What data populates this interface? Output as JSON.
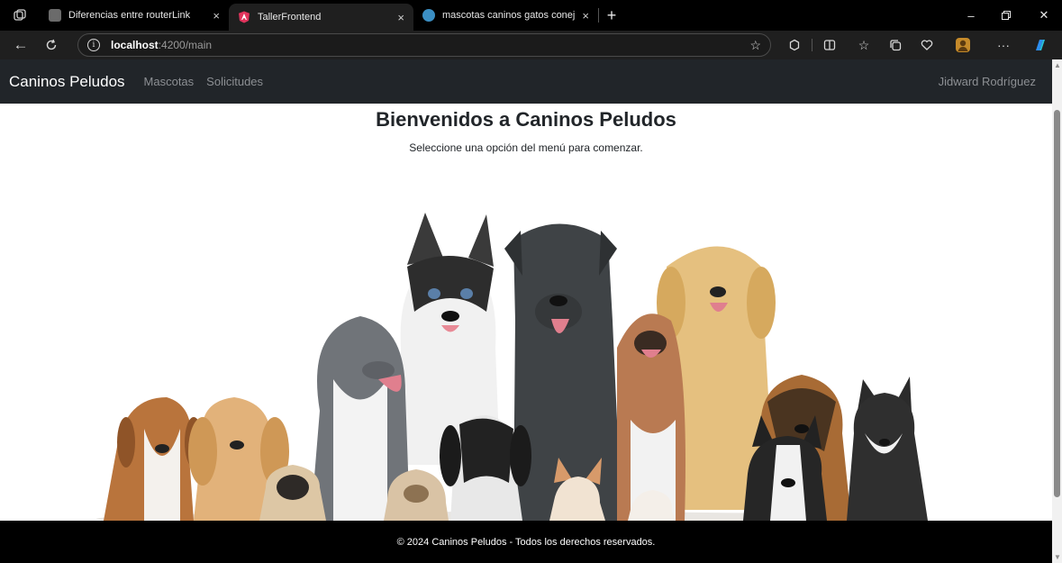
{
  "browser": {
    "tabs": [
      {
        "title": "Diferencias entre routerLink",
        "active": false
      },
      {
        "title": "TallerFrontend",
        "active": true
      },
      {
        "title": "mascotas caninos gatos conejos",
        "active": false
      }
    ],
    "new_tab_symbol": "+",
    "close_symbol": "×",
    "url": {
      "host": "localhost",
      "path": ":4200/main"
    }
  },
  "site": {
    "brand": "Caninos Peludos",
    "nav": [
      {
        "label": "Mascotas"
      },
      {
        "label": "Solicitudes"
      }
    ],
    "user": "Jidward Rodríguez",
    "heading": "Bienvenidos a Caninos Peludos",
    "subheading": "Seleccione una opción del menú para comenzar.",
    "footer": "© 2024 Caninos Peludos - Todos los derechos reservados."
  },
  "icons": {
    "tab_actions": "tab-actions-icon",
    "back": "arrow-left-icon",
    "refresh": "refresh-icon",
    "info": "info-icon",
    "favorite": "star-icon"
  },
  "colors": {
    "navbar": "#212529",
    "footer": "#000000",
    "browser_frame": "#1f1f1f"
  }
}
